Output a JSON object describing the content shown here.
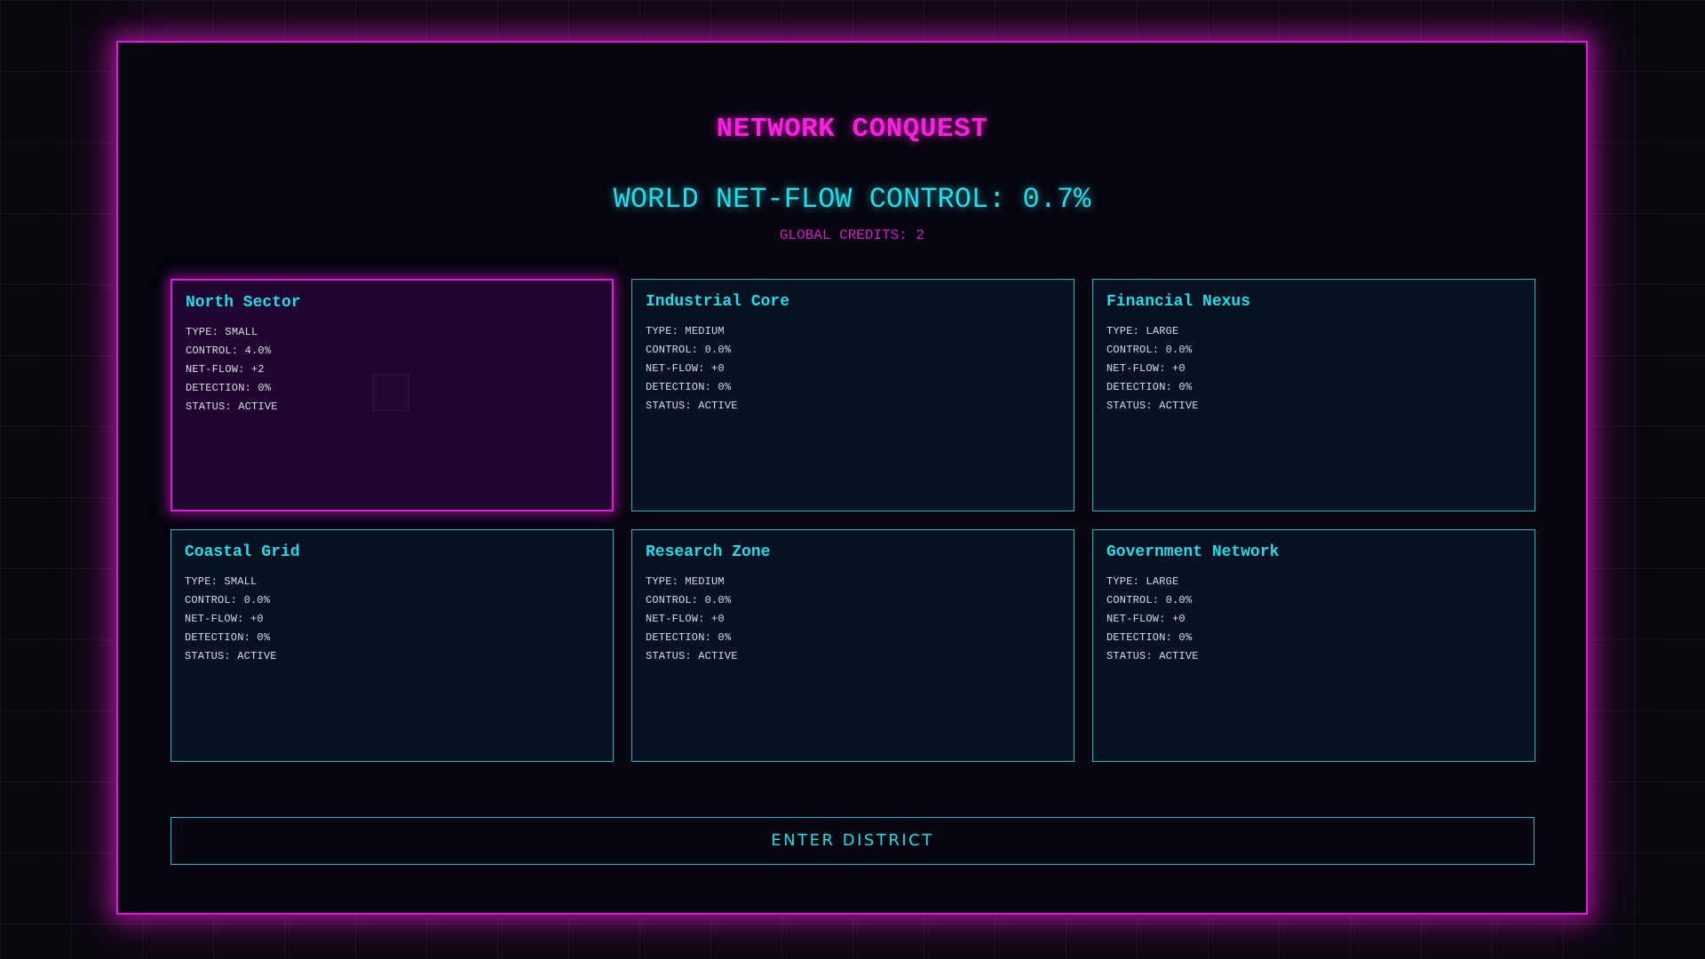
{
  "header": {
    "title": "NETWORK CONQUEST",
    "world_control_label": "WORLD NET-FLOW CONTROL: ",
    "world_control_value": "0.7%",
    "credits_label": "GLOBAL CREDITS: ",
    "credits_value": "2"
  },
  "labels": {
    "type": "TYPE: ",
    "control": "CONTROL: ",
    "net_flow": "NET-FLOW: ",
    "detection": "DETECTION: ",
    "status": "STATUS: "
  },
  "districts": [
    {
      "name": "North Sector",
      "type": "SMALL",
      "control": "4.0%",
      "net_flow": "+2",
      "detection": "0%",
      "status": "ACTIVE",
      "selected": true
    },
    {
      "name": "Industrial Core",
      "type": "MEDIUM",
      "control": "0.0%",
      "net_flow": "+0",
      "detection": "0%",
      "status": "ACTIVE",
      "selected": false
    },
    {
      "name": "Financial Nexus",
      "type": "LARGE",
      "control": "0.0%",
      "net_flow": "+0",
      "detection": "0%",
      "status": "ACTIVE",
      "selected": false
    },
    {
      "name": "Coastal Grid",
      "type": "SMALL",
      "control": "0.0%",
      "net_flow": "+0",
      "detection": "0%",
      "status": "ACTIVE",
      "selected": false
    },
    {
      "name": "Research Zone",
      "type": "MEDIUM",
      "control": "0.0%",
      "net_flow": "+0",
      "detection": "0%",
      "status": "ACTIVE",
      "selected": false
    },
    {
      "name": "Government Network",
      "type": "LARGE",
      "control": "0.0%",
      "net_flow": "+0",
      "detection": "0%",
      "status": "ACTIVE",
      "selected": false
    }
  ],
  "actions": {
    "enter_label": "ENTER DISTRICT"
  },
  "colors": {
    "accent_magenta": "#e619d9",
    "accent_cyan": "#22dde8",
    "card_background": "#061222",
    "selected_background": "#200530"
  }
}
